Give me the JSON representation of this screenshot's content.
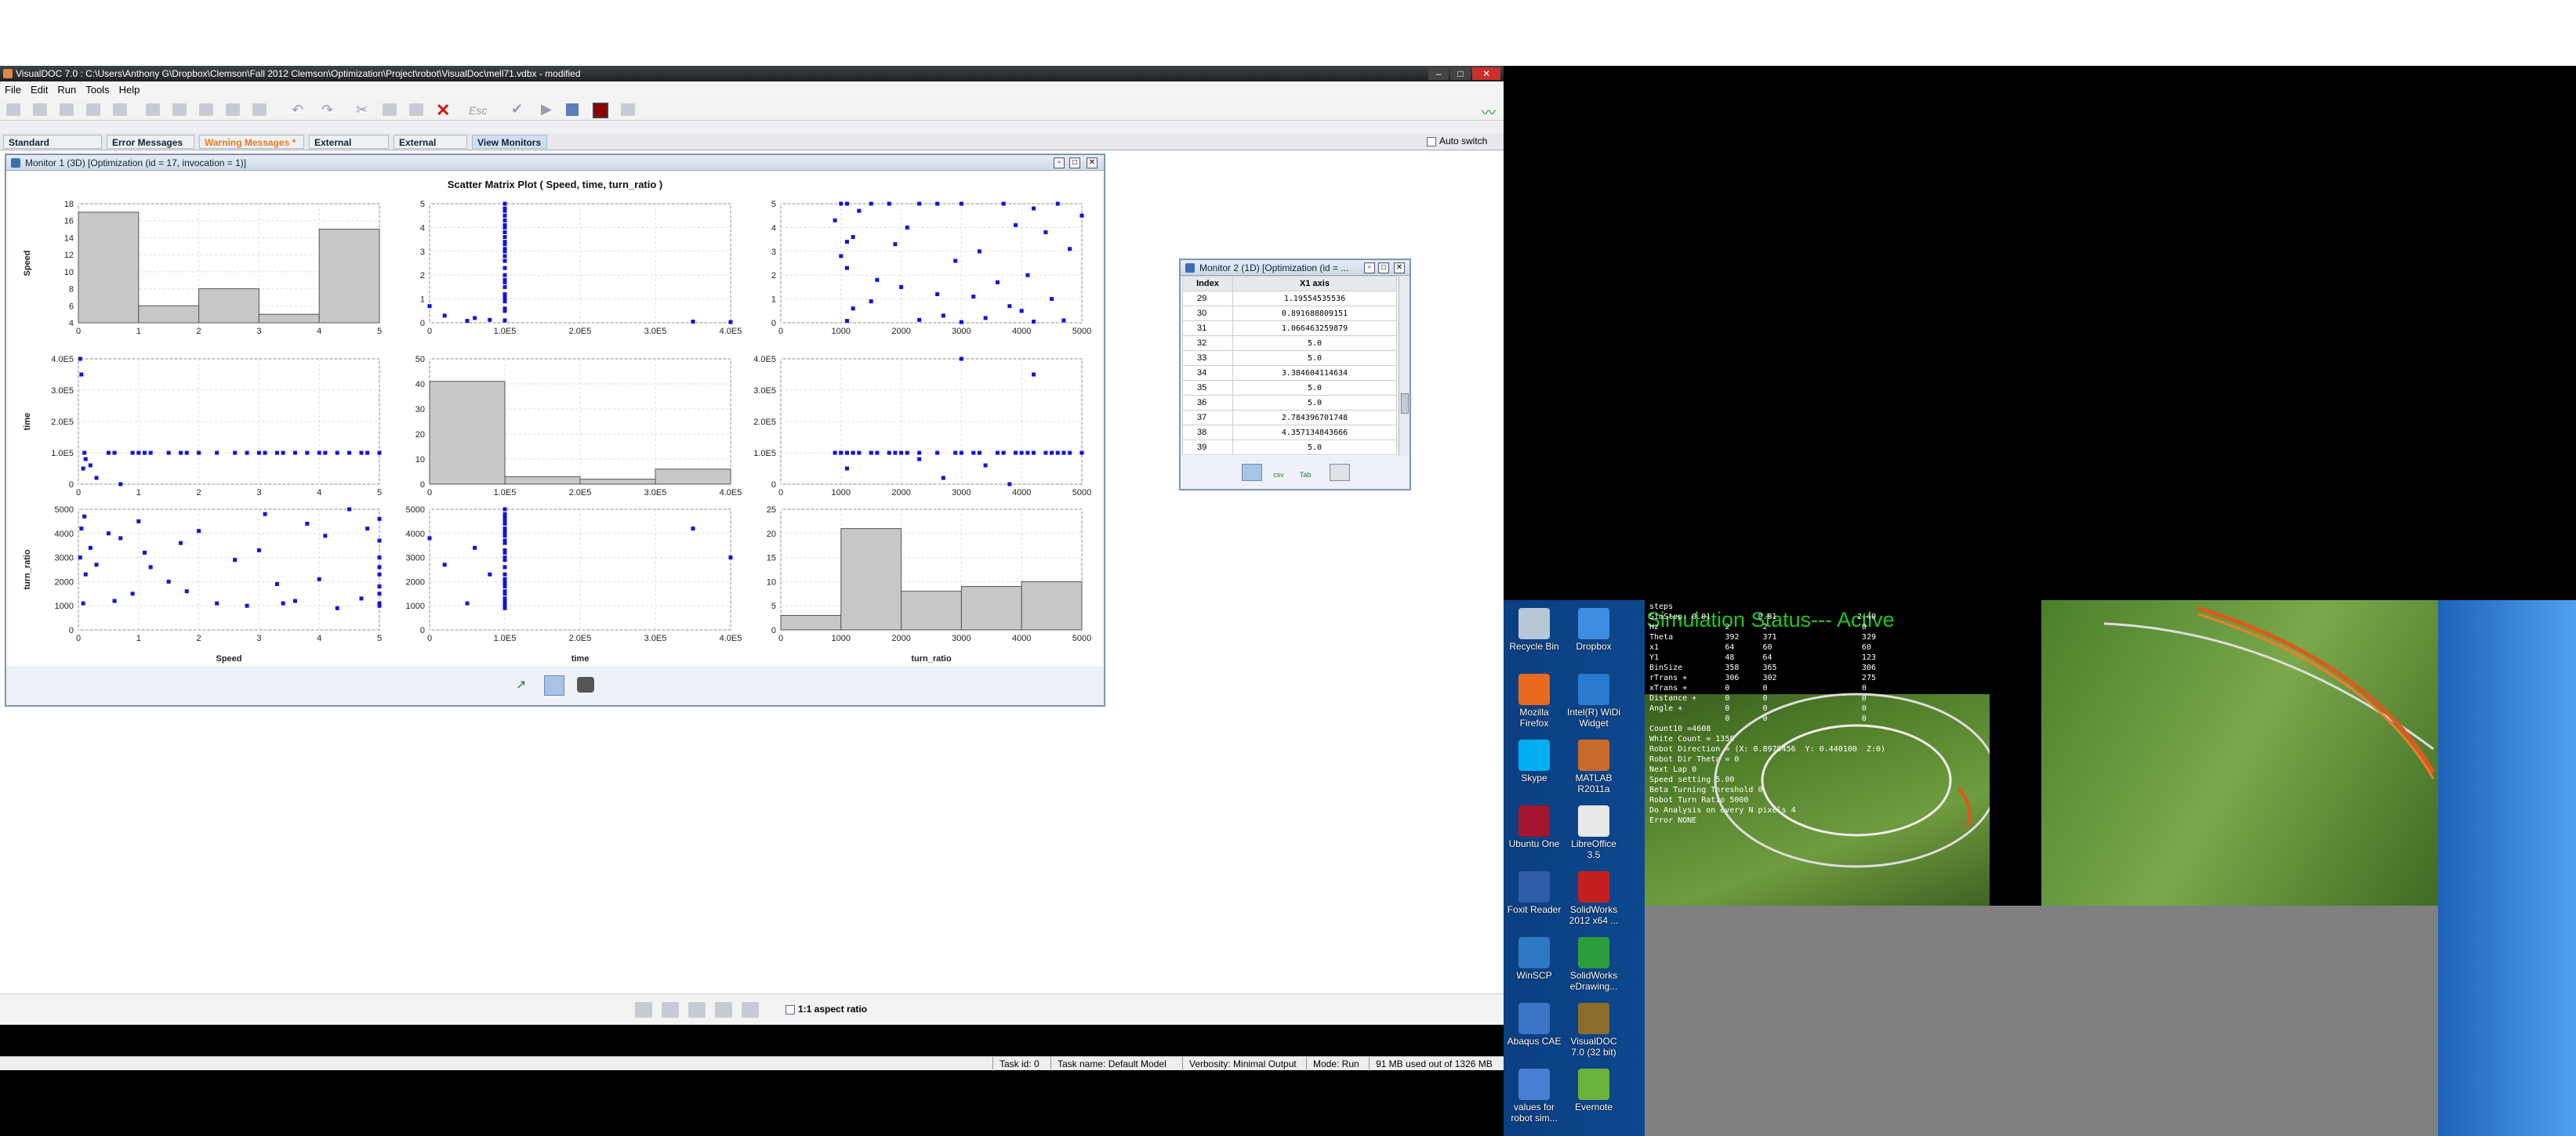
{
  "window": {
    "title": "VisualDOC 7.0 : C:\\Users\\Anthony G\\Dropbox\\Clemson\\Fall 2012 Clemson\\Optimization\\Project\\robot\\VisualDoc\\mell71.vdbx - modified"
  },
  "menu": [
    "File",
    "Edit",
    "Run",
    "Tools",
    "Help"
  ],
  "toolbar": {
    "esc_label": "Esc"
  },
  "tabs": [
    "Standard Messages",
    "Error Messages",
    "Warning Messages *",
    "External Output",
    "External Error",
    "View Monitors"
  ],
  "auto_switch": "Auto switch",
  "monitor1": {
    "title": "Monitor 1 (3D) [Optimization (id = 17, invocation = 1)]",
    "plot_title": "Scatter Matrix Plot ( Speed, time, turn_ratio )"
  },
  "monitor2": {
    "title": "Monitor 2 (1D) [Optimization (id = ... ",
    "col_index": "Index",
    "col_value": "X1 axis",
    "rows": [
      {
        "index": "29",
        "value": "1.19554535536"
      },
      {
        "index": "30",
        "value": "0.891688809151"
      },
      {
        "index": "31",
        "value": "1.066463259879"
      },
      {
        "index": "32",
        "value": "5.0"
      },
      {
        "index": "33",
        "value": "5.0"
      },
      {
        "index": "34",
        "value": "3.384604114634"
      },
      {
        "index": "35",
        "value": "5.0"
      },
      {
        "index": "36",
        "value": "5.0"
      },
      {
        "index": "37",
        "value": "2.784396701748"
      },
      {
        "index": "38",
        "value": "4.357134843666"
      },
      {
        "index": "39",
        "value": "5.0"
      }
    ],
    "buttons": [
      "",
      "csv",
      "Tab",
      ""
    ]
  },
  "bottom": {
    "aspect": "1:1 aspect ratio"
  },
  "status": [
    "Task id: 0",
    "Task name: Default Model",
    "Verbosity: Minimal Output",
    "Mode: Run",
    "91 MB used out of 1326 MB"
  ],
  "desktop_icons": [
    {
      "label1": "Recycle Bin",
      "label2": "",
      "color": "#b6c7d6"
    },
    {
      "label1": "Dropbox",
      "label2": "",
      "color": "#3d8ee2"
    },
    {
      "label1": "Mozilla",
      "label2": "Firefox",
      "color": "#e76a1e"
    },
    {
      "label1": "Intel(R) WiDi",
      "label2": "Widget",
      "color": "#2a7bd0"
    },
    {
      "label1": "Skype",
      "label2": "",
      "color": "#00aff0"
    },
    {
      "label1": "MATLAB",
      "label2": "R2011a",
      "color": "#c86a2c"
    },
    {
      "label1": "Ubuntu One",
      "label2": "",
      "color": "#a3152d"
    },
    {
      "label1": "LibreOffice",
      "label2": "3.5",
      "color": "#e8e8e8"
    },
    {
      "label1": "Foxit Reader",
      "label2": "",
      "color": "#2e5ca8"
    },
    {
      "label1": "SolidWorks",
      "label2": "2012 x64 ...",
      "color": "#c41e1e"
    },
    {
      "label1": "WinSCP",
      "label2": "",
      "color": "#2e77c3"
    },
    {
      "label1": "SolidWorks",
      "label2": "eDrawing...",
      "color": "#2b9e3b"
    },
    {
      "label1": "Abaqus CAE",
      "label2": "",
      "color": "#3b74c4"
    },
    {
      "label1": "VisualDOC",
      "label2": "7.0 (32 bit)",
      "color": "#8b6d2b"
    },
    {
      "label1": "values for",
      "label2": "robot sim...",
      "color": "#4a7ed2"
    },
    {
      "label1": "Evernote",
      "label2": "",
      "color": "#6bb33b"
    }
  ],
  "sim": {
    "status": "Simulation Status--- Active",
    "readout": "steps\nSimStep: 0.01          0.81                 2.40\nHz              2       2                    0\nTheta           392     371                  329\nx1              64      60                   60\nY1              48      64                   123\nBinSize         358     365                  306\nrTrans +        306     302                  275\nxTrans +        0       0                    0\nDistance +      0       0                    0\nAngle +         0       0                    0\n                0       0                    0\nCount10 =4608\nWhite Count = 1358\nRobot Direction = (X: 0.8979456  Y: 0.440100  Z:0)\nRobot Dir Theta = 0\nNext Lap 0\nSpeed setting 5.00\nBeta Turning Threshold 0\nRobot Turn Ratio 5000\nDo Analysis on every N pixels 4\nError NONE"
  },
  "chart_data": {
    "type": "scatter",
    "title": "Scatter Matrix Plot ( Speed, time, turn_ratio )",
    "variables": [
      "Speed",
      "time",
      "turn_ratio"
    ],
    "ranges": {
      "Speed": [
        0,
        5
      ],
      "time": [
        0,
        400000
      ],
      "turn_ratio": [
        0,
        5000
      ]
    },
    "ticks": {
      "Speed": [
        "0",
        "1",
        "2",
        "3",
        "4",
        "5"
      ],
      "time": [
        "0",
        "1.0E5",
        "2.0E5",
        "3.0E5",
        "4.0E5"
      ],
      "turn_ratio": [
        "0",
        "1000",
        "2000",
        "3000",
        "4000",
        "5000"
      ]
    },
    "y_ticks": {
      "Speed": [
        "4",
        "6",
        "8",
        "10",
        "12",
        "14",
        "16",
        "18"
      ],
      "time": [
        "0",
        "1.0E5",
        "2.0E5",
        "3.0E5",
        "4.0E5"
      ],
      "turn_ratio": [
        "0",
        "1000",
        "2000",
        "3000",
        "4000",
        "5000"
      ]
    },
    "histograms": {
      "Speed": {
        "edges": [
          0,
          1,
          2,
          3,
          4,
          5
        ],
        "counts": [
          17,
          6,
          8,
          5,
          15
        ],
        "ylim": [
          4,
          18
        ]
      },
      "time": {
        "edges": [
          0,
          100000,
          200000,
          300000,
          400000
        ],
        "counts": [
          41,
          3,
          2,
          6
        ],
        "ylim": [
          0,
          50
        ],
        "y_ticks": [
          "0",
          "10",
          "20",
          "30",
          "40",
          "50"
        ]
      },
      "turn_ratio": {
        "edges": [
          0,
          1000,
          2000,
          3000,
          4000,
          5000
        ],
        "counts": [
          3,
          21,
          8,
          9,
          10
        ],
        "ylim": [
          0,
          25
        ],
        "y_ticks": [
          "0",
          "5",
          "10",
          "15",
          "20",
          "25"
        ]
      }
    },
    "points": {
      "Speed": [
        0.03,
        0.05,
        0.08,
        0.1,
        0.12,
        0.2,
        0.3,
        0.5,
        0.6,
        0.7,
        0.9,
        1.0,
        1.1,
        1.2,
        1.5,
        1.7,
        1.8,
        2.0,
        2.3,
        2.6,
        2.8,
        3.0,
        3.1,
        3.3,
        3.4,
        3.6,
        3.8,
        4.0,
        4.1,
        4.3,
        4.5,
        4.7,
        4.8,
        5.0,
        5.0,
        5.0,
        5.0,
        5.0,
        5.0,
        5.0,
        5.0,
        5.0
      ],
      "time": [
        400000,
        350000,
        50000,
        100000,
        80000,
        60000,
        20000,
        100000,
        100000,
        0,
        100000,
        100000,
        100000,
        100000,
        100000,
        100000,
        100000,
        100000,
        100000,
        100000,
        100000,
        100000,
        100000,
        100000,
        100000,
        100000,
        100000,
        100000,
        100000,
        100000,
        100000,
        100000,
        100000,
        100000,
        100000,
        100000,
        100000,
        100000,
        100000,
        100000,
        100000,
        100000
      ],
      "turn_ratio": [
        3000,
        4200,
        1100,
        4700,
        2300,
        3400,
        2700,
        4000,
        1200,
        3800,
        1500,
        4500,
        3200,
        2600,
        2000,
        3600,
        1600,
        4100,
        1100,
        2900,
        1000,
        3300,
        4800,
        1900,
        1100,
        1200,
        4400,
        2100,
        3900,
        900,
        5000,
        1300,
        4200,
        2600,
        1800,
        3700,
        1500,
        4600,
        1100,
        2300,
        3000,
        1000
      ]
    }
  }
}
